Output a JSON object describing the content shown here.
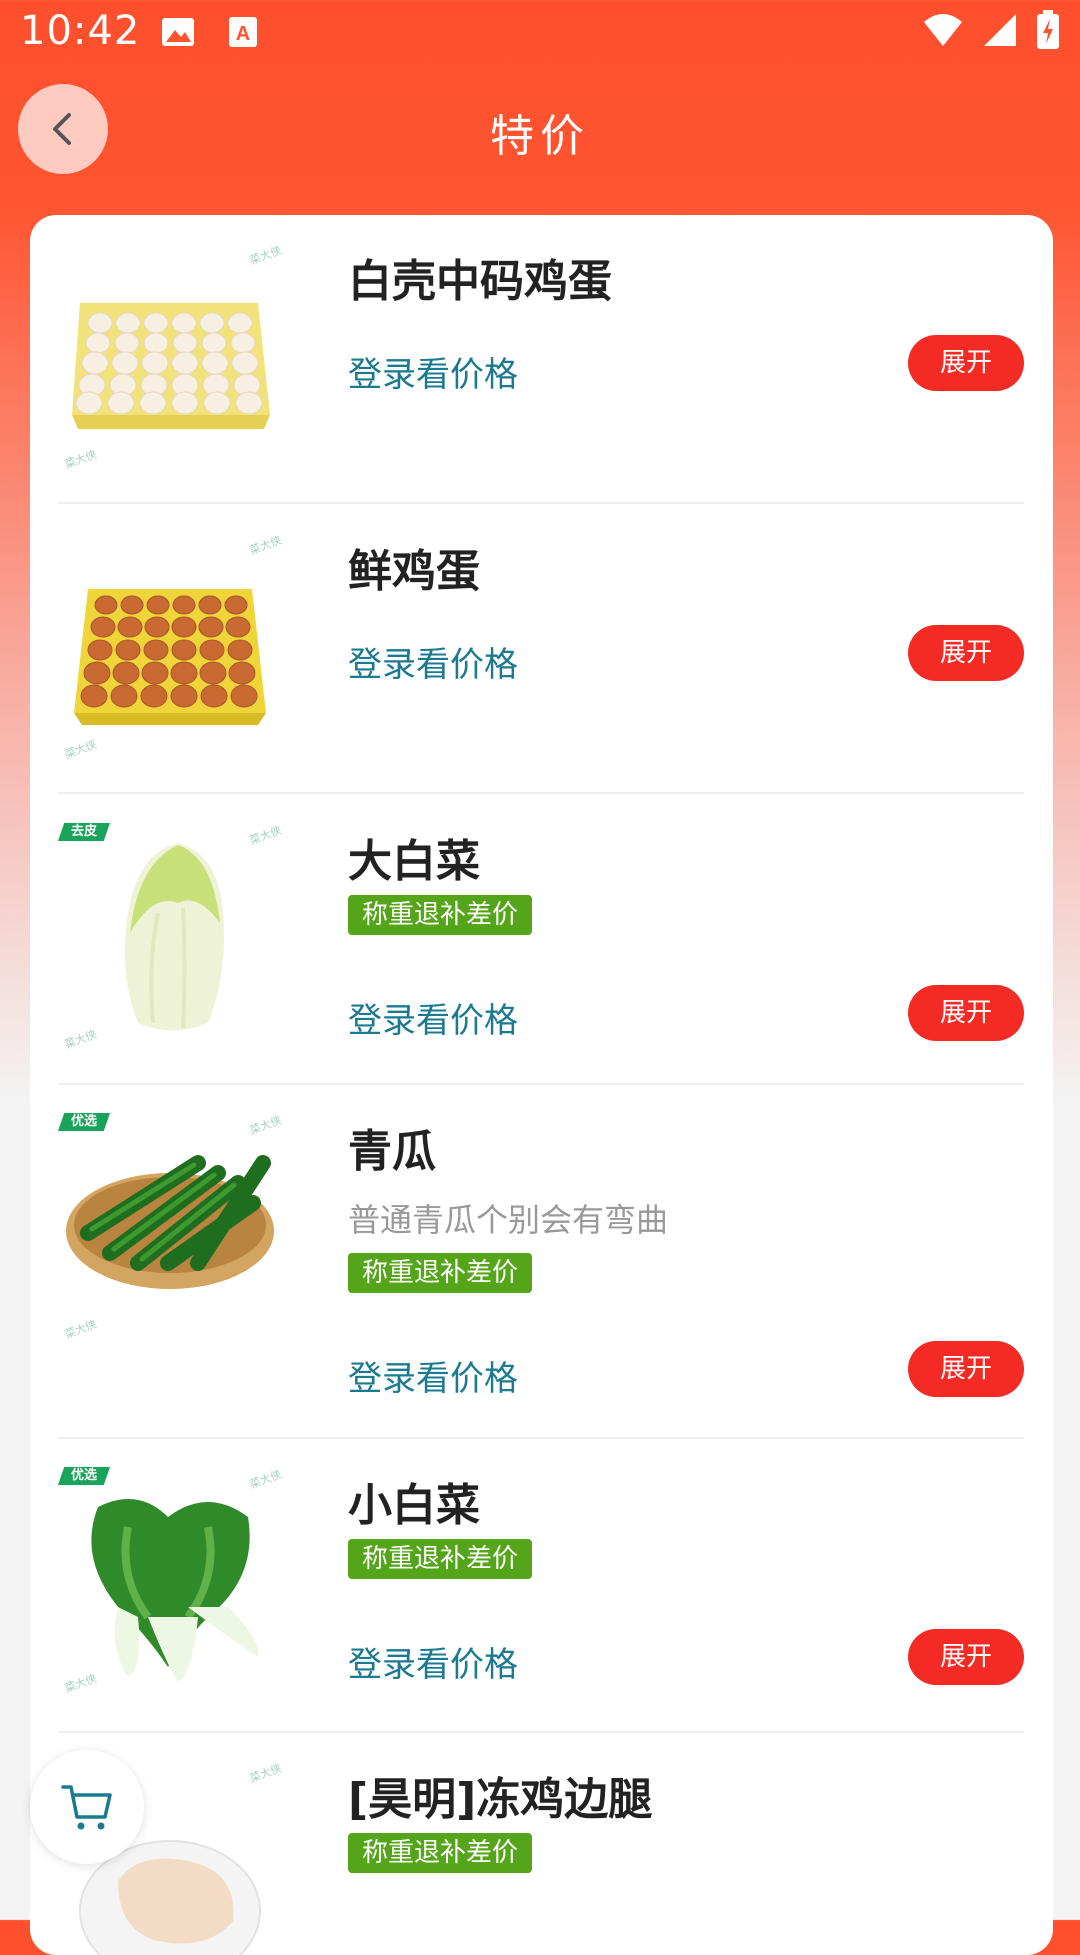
{
  "status_bar": {
    "time": "10:42"
  },
  "header": {
    "title": "特价"
  },
  "items": [
    {
      "name": "白壳中码鸡蛋",
      "price_text": "登录看价格",
      "expand_label": "展开",
      "watermark": "菜大侠"
    },
    {
      "name": "鲜鸡蛋",
      "price_text": "登录看价格",
      "expand_label": "展开",
      "watermark": "菜大侠"
    },
    {
      "name": "大白菜",
      "badge": "去皮",
      "tag": "称重退补差价",
      "price_text": "登录看价格",
      "expand_label": "展开",
      "watermark": "菜大侠"
    },
    {
      "name": "青瓜",
      "badge": "优选",
      "desc": "普通青瓜个别会有弯曲",
      "tag": "称重退补差价",
      "price_text": "登录看价格",
      "expand_label": "展开",
      "watermark": "菜大侠"
    },
    {
      "name": "小白菜",
      "badge": "优选",
      "tag": "称重退补差价",
      "price_text": "登录看价格",
      "expand_label": "展开",
      "watermark": "菜大侠"
    },
    {
      "name": "[昊明]冻鸡边腿",
      "tag": "称重退补差价",
      "watermark": "菜大侠"
    }
  ],
  "colors": {
    "header": "#ff5430",
    "expand_button": "#f42a25",
    "tag": "#55a51a",
    "price_link": "#1b7a90"
  }
}
